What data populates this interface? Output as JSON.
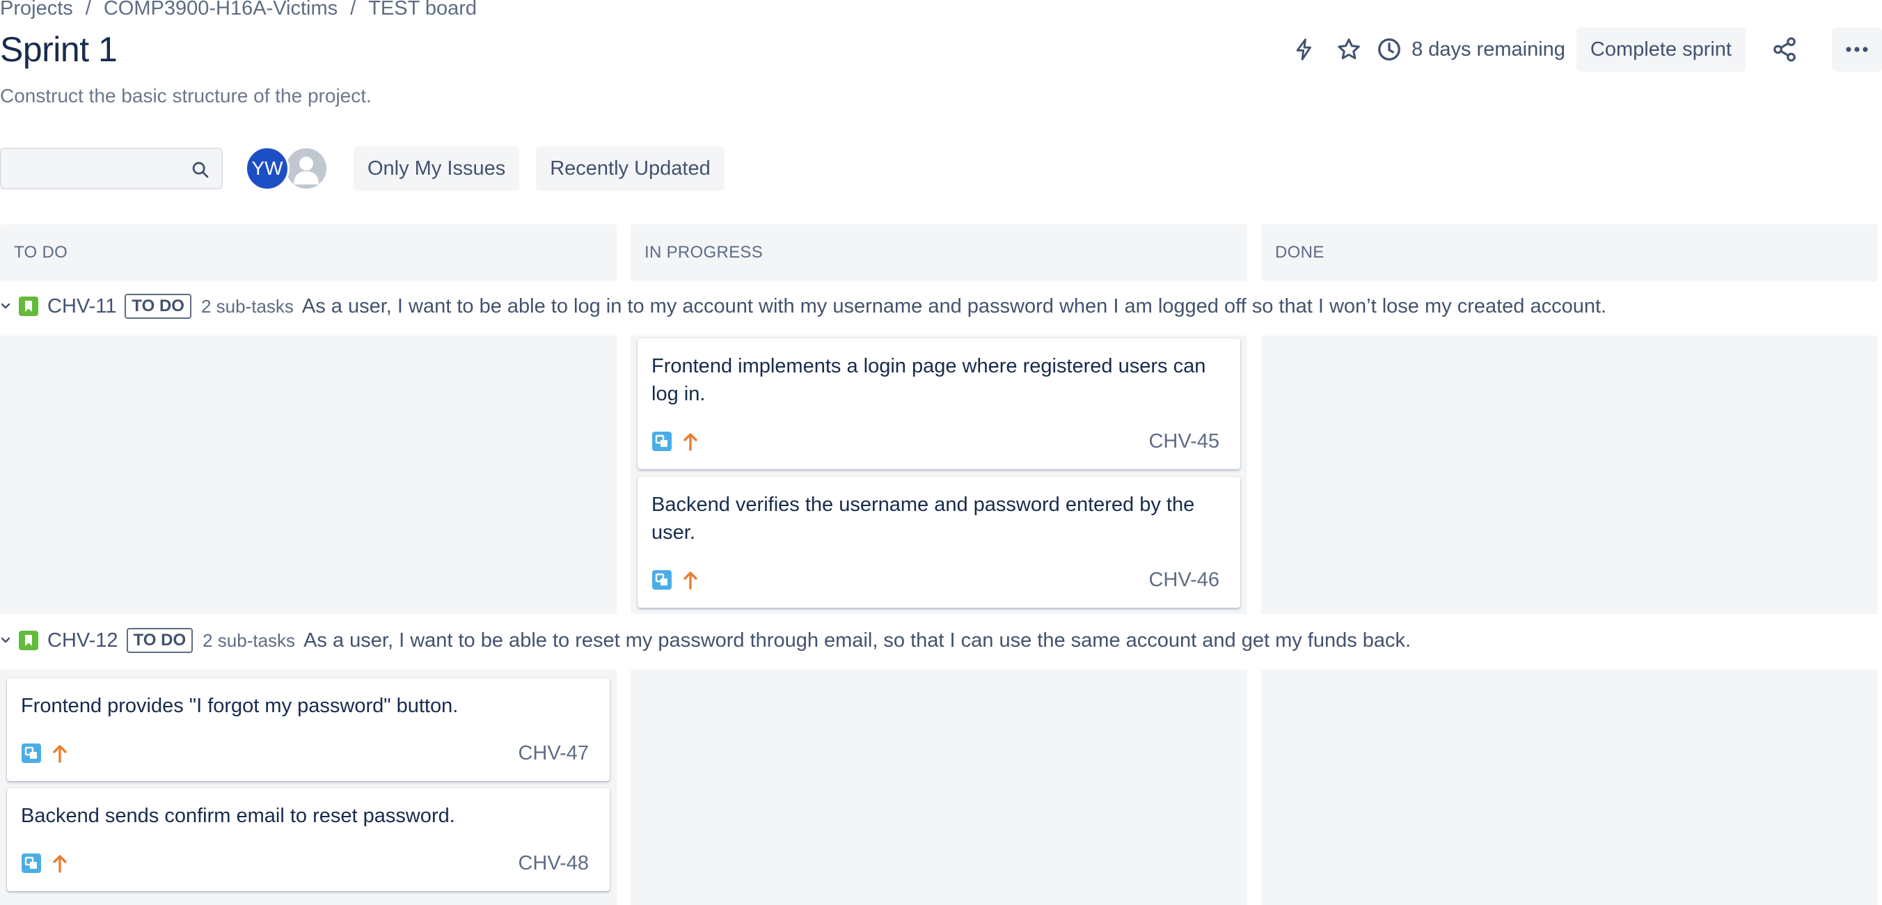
{
  "breadcrumb": {
    "items": [
      "Projects",
      "COMP3900-H16A-Victims",
      "TEST board"
    ],
    "separator": "/"
  },
  "sprint": {
    "title": "Sprint 1",
    "goal": "Construct the basic structure of the project.",
    "remaining": "8 days remaining",
    "complete_label": "Complete sprint"
  },
  "filters": {
    "search_placeholder": "",
    "avatar_initials": "YW",
    "quick_filters": [
      "Only My Issues",
      "Recently Updated"
    ]
  },
  "columns": [
    "TO DO",
    "IN PROGRESS",
    "DONE"
  ],
  "swimlanes": [
    {
      "key": "CHV-11",
      "status": "TO DO",
      "subtasks": "2 sub-tasks",
      "summary": "As a user, I want to be able to log in to my account with my username and password when I am logged off so that I won’t lose my created account.",
      "cards": [
        {
          "column": "IN PROGRESS",
          "summary": "Frontend implements a login page where registered users can log in.",
          "key": "CHV-45"
        },
        {
          "column": "IN PROGRESS",
          "summary": "Backend verifies the username and password entered by the user.",
          "key": "CHV-46"
        }
      ]
    },
    {
      "key": "CHV-12",
      "status": "TO DO",
      "subtasks": "2 sub-tasks",
      "summary": "As a user, I want to be able to reset my password through email, so that I can use the same account and get my funds back.",
      "cards": [
        {
          "column": "TO DO",
          "summary": "Frontend provides \"I forgot my password\" button.",
          "key": "CHV-47"
        },
        {
          "column": "TO DO",
          "summary": "Backend sends confirm email to reset password.",
          "key": "CHV-48"
        }
      ]
    }
  ],
  "icons": {
    "header": [
      "lightning-icon",
      "star-icon",
      "clock-icon",
      "share-icon",
      "more-icon"
    ],
    "card": [
      "subtask-icon",
      "priority-high-icon"
    ],
    "lane": [
      "chevron-down-icon",
      "story-icon"
    ]
  },
  "colors": {
    "avatar": "#1d4fc4",
    "story": "#63ba3c",
    "subtask": "#4bade8",
    "priority_high": "#e97f33",
    "column_bg": "#f4f5f7"
  }
}
